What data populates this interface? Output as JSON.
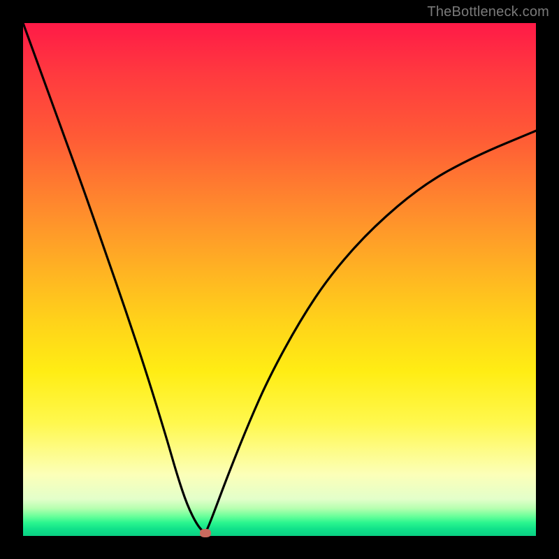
{
  "watermark": "TheBottleneck.com",
  "chart_data": {
    "type": "line",
    "title": "",
    "xlabel": "",
    "ylabel": "",
    "xlim": [
      0,
      100
    ],
    "ylim": [
      0,
      100
    ],
    "grid": false,
    "legend": false,
    "series": [
      {
        "name": "bottleneck-curve",
        "x": [
          0,
          4,
          8,
          12,
          16,
          20,
          24,
          28,
          30,
          32,
          34,
          35.5,
          36,
          37,
          40,
          44,
          48,
          54,
          60,
          68,
          78,
          88,
          100
        ],
        "values": [
          100,
          89,
          78,
          67,
          55.5,
          44,
          32,
          19,
          12,
          6,
          2,
          0.5,
          1.5,
          4,
          12,
          22,
          31,
          42,
          51,
          60,
          68.5,
          74,
          79
        ]
      }
    ],
    "marker": {
      "x": 35.5,
      "y": 0.5
    },
    "gradient_stops": [
      {
        "pos": 0,
        "color": "#ff1a47"
      },
      {
        "pos": 50,
        "color": "#ffd21a"
      },
      {
        "pos": 95,
        "color": "#b7ffb0"
      },
      {
        "pos": 100,
        "color": "#0ad083"
      }
    ]
  }
}
